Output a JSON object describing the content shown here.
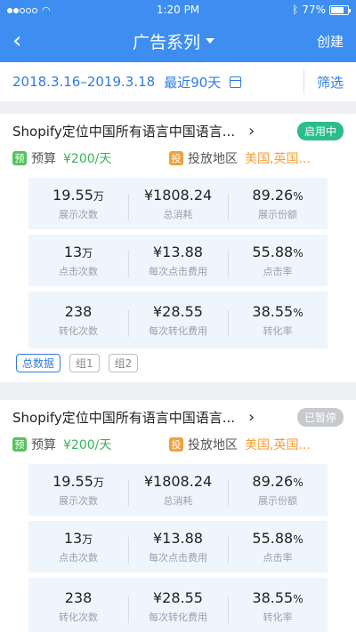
{
  "status": {
    "time": "1:20 PM",
    "battery": "77%",
    "battery_level": 0.77
  },
  "nav": {
    "back": "‹",
    "title": "广告系列",
    "action": "创建"
  },
  "filter": {
    "date_range": "2018.3.16–2019.3.18",
    "quick_range": "最近90天",
    "filter_label": "筛选"
  },
  "campaigns": [
    {
      "title": "Shopify定位中国所有语言中国语言...",
      "status": "启用中",
      "budget_tag": "预",
      "budget_label": "预算",
      "budget_value": "¥200/天",
      "region_tag": "投",
      "region_label": "投放地区",
      "region_value": "美国,英国...",
      "stats": [
        [
          {
            "value": "19.55",
            "unit": "万",
            "label": "展示次数"
          },
          {
            "value": "¥1808.24",
            "unit": "",
            "label": "总消耗"
          },
          {
            "value": "89.26",
            "unit": "%",
            "label": "展示份额"
          }
        ],
        [
          {
            "value": "13",
            "unit": "万",
            "label": "点击次数"
          },
          {
            "value": "¥13.88",
            "unit": "",
            "label": "每次点击费用"
          },
          {
            "value": "55.88",
            "unit": "%",
            "label": "点击率"
          }
        ],
        [
          {
            "value": "238",
            "unit": "",
            "label": "转化次数"
          },
          {
            "value": "¥28.55",
            "unit": "",
            "label": "每次转化费用"
          },
          {
            "value": "38.55",
            "unit": "%",
            "label": "转化率"
          }
        ]
      ],
      "chips": [
        "总数据",
        "组1",
        "组2"
      ]
    },
    {
      "title": "Shopify定位中国所有语言中国语言...",
      "status": "已暂停",
      "budget_tag": "预",
      "budget_label": "预算",
      "budget_value": "¥200/天",
      "region_tag": "投",
      "region_label": "投放地区",
      "region_value": "美国,英国...",
      "stats": [
        [
          {
            "value": "19.55",
            "unit": "万",
            "label": "展示次数"
          },
          {
            "value": "¥1808.24",
            "unit": "",
            "label": "总消耗"
          },
          {
            "value": "89.26",
            "unit": "%",
            "label": "展示份额"
          }
        ],
        [
          {
            "value": "13",
            "unit": "万",
            "label": "点击次数"
          },
          {
            "value": "¥13.88",
            "unit": "",
            "label": "每次点击费用"
          },
          {
            "value": "55.88",
            "unit": "%",
            "label": "点击率"
          }
        ],
        [
          {
            "value": "238",
            "unit": "",
            "label": "转化次数"
          },
          {
            "value": "¥28.55",
            "unit": "",
            "label": "每次转化费用"
          },
          {
            "value": "38.55",
            "unit": "%",
            "label": "转化率"
          }
        ]
      ]
    }
  ]
}
